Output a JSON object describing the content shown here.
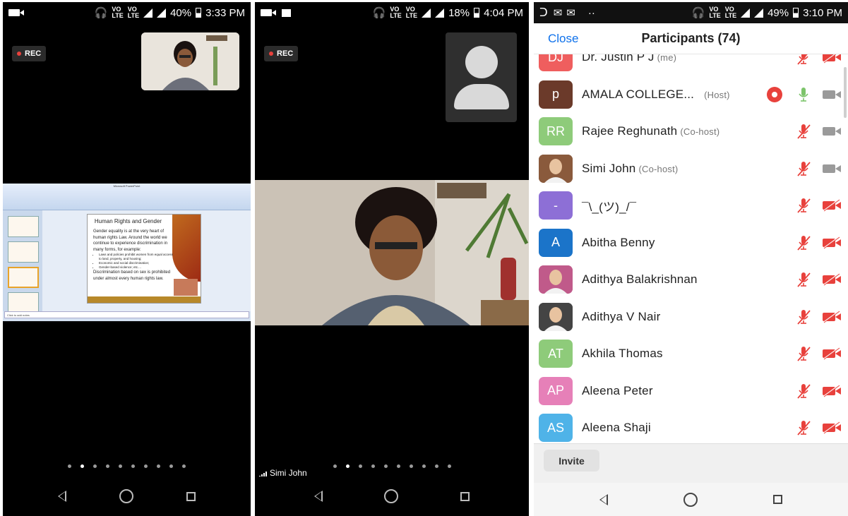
{
  "panel1": {
    "status": {
      "battery": "40%",
      "time": "3:33 PM"
    },
    "rec_label": "REC",
    "slide": {
      "title": "Human Rights and Gender",
      "para1": "Gender equality is at the very heart of human rights Law. Around the world we continue to experience discrimination in many forms, for example:",
      "bullets": [
        "Laws and policies prohibit women from equal access to land, property, and housing;",
        "Economic and social discrimination;",
        "Gender-based violence; etc...."
      ],
      "para2": "Discrimination based on sex is prohibited under almost every human rights law.",
      "notes": "Click to add notes"
    }
  },
  "panel2": {
    "status": {
      "battery": "18%",
      "time": "4:04 PM"
    },
    "rec_label": "REC",
    "speaker_name": "Simi John"
  },
  "panel3": {
    "status": {
      "battery": "49%",
      "time": "3:10 PM"
    },
    "close_label": "Close",
    "title": "Participants (74)",
    "participants": [
      {
        "initials": "DJ",
        "name": "Dr. Justin P J",
        "role": "(me)",
        "color": "#ef5e5e",
        "mic": "muted",
        "cam": "off"
      },
      {
        "initials": "p",
        "name": "AMALA COLLEGE...",
        "role": "(Host)",
        "color": "#6b3a2a",
        "mic": "on",
        "cam": "on",
        "recording": true
      },
      {
        "initials": "RR",
        "name": "Rajee Reghunath",
        "role": "(Co-host)",
        "color": "#8ecb7a",
        "mic": "muted",
        "cam": "on"
      },
      {
        "initials": "",
        "name": "Simi John",
        "role": "(Co-host)",
        "color": "#8a5a3c",
        "mic": "muted",
        "cam": "on",
        "photo": true
      },
      {
        "initials": "-",
        "name": "¯\\_(ツ)_/¯",
        "role": "",
        "color": "#8d6fd6",
        "mic": "muted",
        "cam": "off"
      },
      {
        "initials": "A",
        "name": "Abitha Benny",
        "role": "",
        "color": "#1b74c9",
        "mic": "muted",
        "cam": "off"
      },
      {
        "initials": "",
        "name": "Adithya Balakrishnan",
        "role": "",
        "color": "#c05a8a",
        "mic": "muted",
        "cam": "off",
        "photo": true
      },
      {
        "initials": "",
        "name": "Adithya V Nair",
        "role": "",
        "color": "#444444",
        "mic": "muted",
        "cam": "off",
        "photo": true
      },
      {
        "initials": "AT",
        "name": "Akhila Thomas",
        "role": "",
        "color": "#8ecb7a",
        "mic": "muted",
        "cam": "off"
      },
      {
        "initials": "AP",
        "name": "Aleena Peter",
        "role": "",
        "color": "#e680b8",
        "mic": "muted",
        "cam": "off"
      },
      {
        "initials": "AS",
        "name": "Aleena Shaji",
        "role": "",
        "color": "#4fb3e8",
        "mic": "muted",
        "cam": "off"
      }
    ],
    "invite_label": "Invite"
  },
  "colors": {
    "zoom_blue": "#0e71eb",
    "muted_red": "#e8413c"
  }
}
